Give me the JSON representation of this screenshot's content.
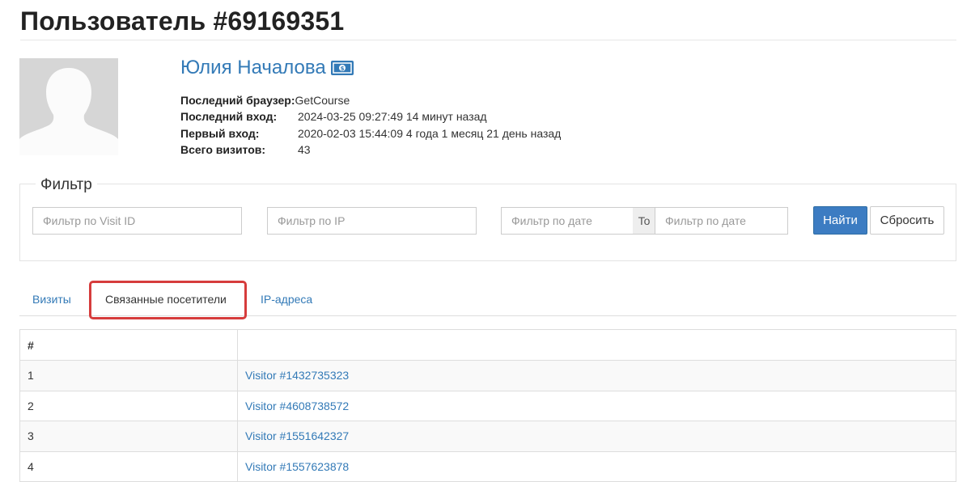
{
  "page": {
    "title": "Пользователь #69169351"
  },
  "user": {
    "name": "Юлия Началова",
    "info": [
      {
        "label": "Последний браузер:",
        "value": "GetCourse"
      },
      {
        "label": "Последний вход:",
        "value": "2024-03-25 09:27:49 14 минут назад"
      },
      {
        "label": "Первый вход:",
        "value": "2020-02-03 15:44:09 4 года 1 месяц 21 день назад"
      },
      {
        "label": "Всего визитов:",
        "value": "43"
      }
    ]
  },
  "filter": {
    "legend": "Фильтр",
    "visit_id_placeholder": "Фильтр по Visit ID",
    "ip_placeholder": "Фильтр по IP",
    "date_from_placeholder": "Фильтр по дате",
    "to_label": "To",
    "date_to_placeholder": "Фильтр по дате",
    "find_label": "Найти",
    "reset_label": "Сбросить"
  },
  "tabs": [
    {
      "label": "Визиты"
    },
    {
      "label": "Связанные посетители"
    },
    {
      "label": "IP-адреса"
    }
  ],
  "table": {
    "headers": [
      "#",
      ""
    ],
    "rows": [
      {
        "num": "1",
        "visitor": "Visitor #1432735323"
      },
      {
        "num": "2",
        "visitor": "Visitor #4608738572"
      },
      {
        "num": "3",
        "visitor": "Visitor #1551642327"
      },
      {
        "num": "4",
        "visitor": "Visitor #1557623878"
      }
    ]
  },
  "colors": {
    "link": "#337ab7",
    "primary_button": "#3c7cc2",
    "highlight": "#d63c3c"
  },
  "icons": {
    "avatar": "user-silhouette-icon",
    "money": "money-bill-icon"
  }
}
